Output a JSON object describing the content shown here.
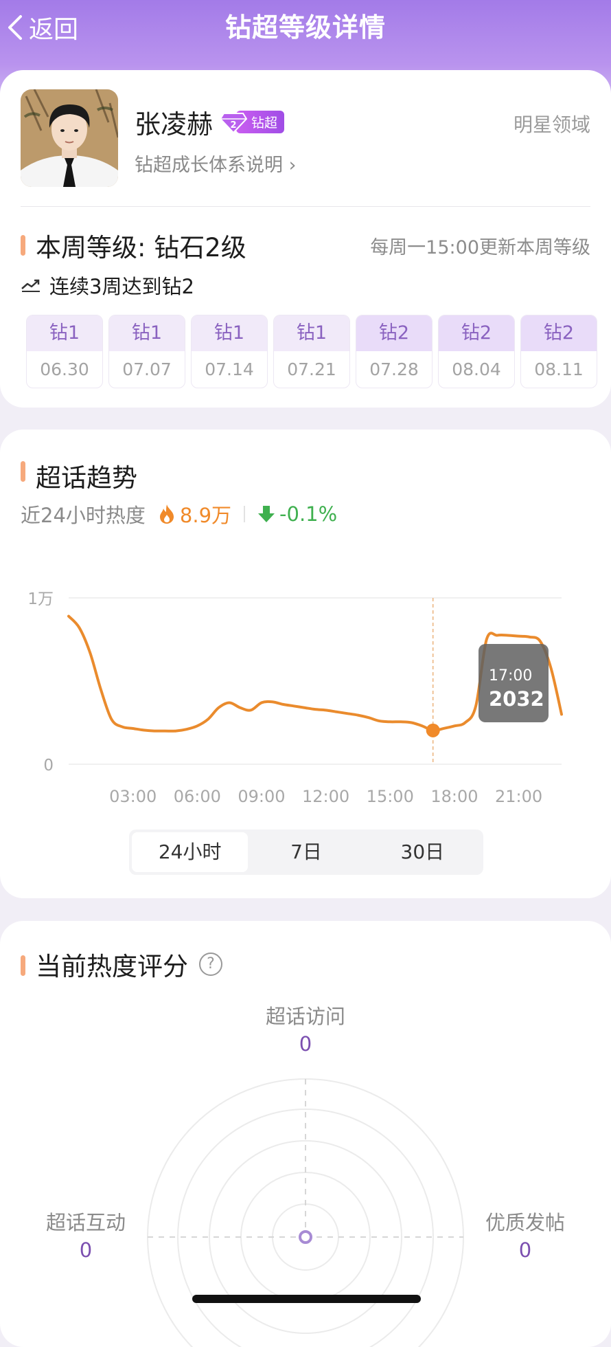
{
  "header": {
    "back_label": "返回",
    "title": "钻超等级详情"
  },
  "profile": {
    "name": "张凌赫",
    "badge_text": "钻超",
    "growth_link": "钻超成长体系说明 ›",
    "realm": "明星领域"
  },
  "level": {
    "current": "本周等级: 钻石2级",
    "update_note": "每周一15:00更新本周等级",
    "streak": "连续3周达到钻2",
    "weeks": [
      {
        "level": "钻1",
        "date": "06.30"
      },
      {
        "level": "钻1",
        "date": "07.07"
      },
      {
        "level": "钻1",
        "date": "07.14"
      },
      {
        "level": "钻1",
        "date": "07.21"
      },
      {
        "level": "钻2",
        "date": "07.28"
      },
      {
        "level": "钻2",
        "date": "08.04"
      },
      {
        "level": "钻2",
        "date": "08.11"
      }
    ]
  },
  "trend": {
    "title": "超话趋势",
    "heat_label": "近24小时热度",
    "heat_value": "8.9万",
    "heat_change": "-0.1%",
    "tabs": [
      "24小时",
      "7日",
      "30日"
    ],
    "active_tab": "24小时"
  },
  "chart_data": {
    "type": "line",
    "ylim": [
      0,
      10000
    ],
    "y_tick_labels": [
      "1万",
      "0"
    ],
    "x_tick_labels": [
      "03:00",
      "06:00",
      "09:00",
      "12:00",
      "15:00",
      "18:00",
      "21:00"
    ],
    "xlim": [
      0,
      23
    ],
    "series": [
      {
        "x": [
          0,
          0.5,
          1.0,
          1.5,
          2.0,
          2.5,
          3.0,
          3.5,
          4.0,
          4.5,
          5.0,
          5.5,
          6.0,
          6.5,
          7.0,
          7.5,
          8.0,
          8.5,
          9.0,
          9.5,
          10.0,
          10.5,
          11.0,
          11.5,
          12.0,
          12.5,
          13.0,
          13.5,
          14.0,
          14.5,
          15.0,
          15.5,
          16.0,
          16.5,
          17.0,
          17.5,
          18.0,
          18.5,
          19.0,
          19.5,
          20.0,
          20.5,
          21.0,
          21.5,
          22.0,
          22.5,
          23.0
        ],
        "y": [
          8900,
          8200,
          6700,
          4500,
          2700,
          2250,
          2150,
          2050,
          2000,
          2000,
          2000,
          2100,
          2300,
          2700,
          3400,
          3700,
          3400,
          3250,
          3700,
          3750,
          3600,
          3500,
          3400,
          3300,
          3250,
          3150,
          3050,
          2950,
          2800,
          2600,
          2550,
          2550,
          2500,
          2300,
          2032,
          2150,
          2300,
          2500,
          3500,
          7500,
          7750,
          7750,
          7700,
          7650,
          7400,
          5800,
          3000
        ]
      }
    ],
    "tooltip": {
      "time": "17:00",
      "value": "2032",
      "x": 17
    }
  },
  "score": {
    "title": "当前热度评分",
    "axes": [
      {
        "label": "超话访问",
        "value": "0"
      },
      {
        "label": "超话互动",
        "value": "0"
      },
      {
        "label": "优质发帖",
        "value": "0"
      }
    ]
  }
}
